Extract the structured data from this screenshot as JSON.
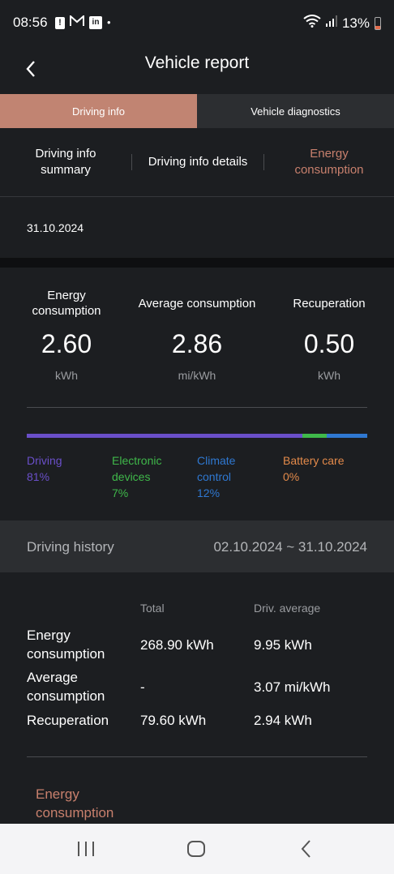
{
  "status_bar": {
    "time": "08:56",
    "left_icons": [
      "alert-icon",
      "gmail-icon",
      "linkedin-icon",
      "dot-icon"
    ],
    "battery_percent": "13%"
  },
  "header": {
    "title": "Vehicle report",
    "back_icon": "chevron-left-icon"
  },
  "top_tabs": [
    {
      "label": "Driving info",
      "active": true
    },
    {
      "label": "Vehicle diagnostics",
      "active": false
    }
  ],
  "sub_tabs": [
    {
      "line1": "Driving info",
      "line2": "summary",
      "active": false
    },
    {
      "line1": "Driving info details",
      "line2": "",
      "active": false
    },
    {
      "line1": "Energy",
      "line2": "consumption",
      "active": true
    }
  ],
  "date": "31.10.2024",
  "stats": [
    {
      "label_line1": "Energy",
      "label_line2": "consumption",
      "value": "2.60",
      "unit": "kWh"
    },
    {
      "label_line1": "Average consumption",
      "label_line2": "",
      "value": "2.86",
      "unit": "mi/kWh"
    },
    {
      "label_line1": "Recuperation",
      "label_line2": "",
      "value": "0.50",
      "unit": "kWh"
    }
  ],
  "breakdown": [
    {
      "name_line1": "Driving",
      "name_line2": "",
      "percent": "81%",
      "fraction": 0.81,
      "color": "#6a4fc9"
    },
    {
      "name_line1": "Electronic",
      "name_line2": "devices",
      "percent": "7%",
      "fraction": 0.07,
      "color": "#3fb84a"
    },
    {
      "name_line1": "Climate",
      "name_line2": "control",
      "percent": "12%",
      "fraction": 0.12,
      "color": "#2f78d1"
    },
    {
      "name_line1": "Battery care",
      "name_line2": "",
      "percent": "0%",
      "fraction": 0.0,
      "color": "#e38a4a"
    }
  ],
  "history": {
    "title": "Driving history",
    "range": "02.10.2024 ~ 31.10.2024",
    "columns": [
      "Total",
      "Driv. average"
    ],
    "rows": [
      {
        "label_line1": "Energy",
        "label_line2": "consumption",
        "total": "268.90 kWh",
        "average": "9.95 kWh"
      },
      {
        "label_line1": "Average",
        "label_line2": "consumption",
        "total": "-",
        "average": "3.07 mi/kWh"
      },
      {
        "label_line1": "Recuperation",
        "label_line2": "",
        "total": "79.60 kWh",
        "average": "2.94 kWh"
      }
    ],
    "section_link_line1": "Energy",
    "section_link_line2": "consumption"
  },
  "nav": [
    "recent-apps-icon",
    "home-icon",
    "back-icon"
  ],
  "colors": {
    "accent": "#c18472",
    "accent_text": "#c8806d",
    "background": "#1c1e21"
  }
}
